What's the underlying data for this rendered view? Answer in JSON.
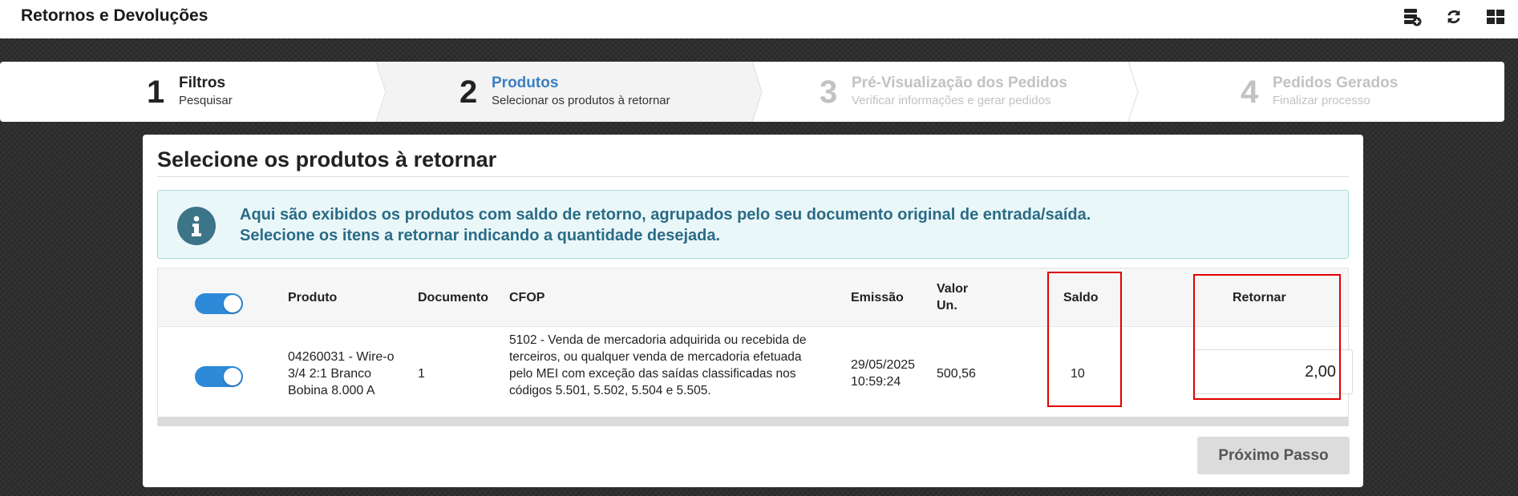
{
  "app": {
    "title": "Retornos e Devoluções"
  },
  "toolbar_icons": [
    "database-add-icon",
    "refresh-icon",
    "layout-grid-icon"
  ],
  "wizard": {
    "steps": [
      {
        "number": "1",
        "title": "Filtros",
        "subtitle": "Pesquisar",
        "state": "done"
      },
      {
        "number": "2",
        "title": "Produtos",
        "subtitle": "Selecionar os produtos à retornar",
        "state": "active"
      },
      {
        "number": "3",
        "title": "Pré-Visualização dos Pedidos",
        "subtitle": "Verificar informações e gerar pedidos",
        "state": "disabled"
      },
      {
        "number": "4",
        "title": "Pedidos Gerados",
        "subtitle": "Finalizar processo",
        "state": "disabled"
      }
    ]
  },
  "panel": {
    "title": "Selecione os produtos à retornar",
    "alert": {
      "line1": "Aqui são exibidos os produtos com saldo de retorno, agrupados pelo seu documento original de entrada/saída.",
      "line2": "Selecione os itens a retornar indicando a quantidade desejada."
    },
    "table": {
      "headers": {
        "produto": "Produto",
        "documento": "Documento",
        "cfop": "CFOP",
        "emissao": "Emissão",
        "valor_line1": "Valor",
        "valor_line2": "Un.",
        "saldo": "Saldo",
        "retornar": "Retornar"
      },
      "select_all": true,
      "rows": [
        {
          "selected": true,
          "produto": [
            "04260031 - Wire-o",
            "3/4 2:1 Branco",
            "Bobina 8.000 A"
          ],
          "documento": "1",
          "cfop": [
            "5102 - Venda de mercadoria adquirida ou recebida de",
            "terceiros, ou qualquer venda de mercadoria efetuada",
            "pelo MEI com exceção das saídas classificadas nos",
            "códigos 5.501, 5.502, 5.504 e 5.505."
          ],
          "emissao": [
            "29/05/2025",
            "10:59:24"
          ],
          "valor_un": "500,56",
          "saldo": "10",
          "retornar": "2,00"
        }
      ]
    },
    "next_button": "Próximo Passo"
  },
  "colors": {
    "accent": "#3a7fc1",
    "toggle_on": "#2c8ad8",
    "alert_text": "#2a6b86",
    "alert_bg": "#eaf7f9",
    "highlight": "#e00000"
  }
}
